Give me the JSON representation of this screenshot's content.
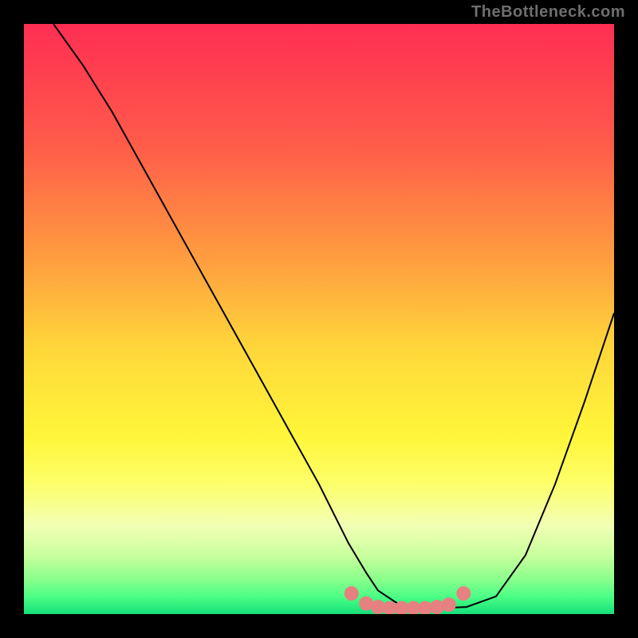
{
  "watermark": "TheBottleneck.com",
  "chart_data": {
    "type": "line",
    "title": "",
    "xlabel": "",
    "ylabel": "",
    "xlim": [
      0,
      100
    ],
    "ylim": [
      0,
      100
    ],
    "series": [
      {
        "name": "bottleneck-curve",
        "color": "#000000",
        "x": [
          5,
          10,
          15,
          20,
          25,
          30,
          35,
          40,
          45,
          50,
          52,
          55,
          58,
          60,
          63,
          65,
          68,
          70,
          75,
          80,
          85,
          90,
          95,
          100
        ],
        "values": [
          100,
          93,
          85,
          76,
          67,
          58,
          49,
          40,
          31,
          22,
          18,
          12,
          7,
          4,
          2,
          1.2,
          1,
          1,
          1.2,
          3,
          10,
          22,
          36,
          51
        ]
      }
    ],
    "markers": {
      "name": "highlight-dots",
      "color": "#e78080",
      "points": [
        {
          "x": 55.5,
          "y": 3.5
        },
        {
          "x": 58.0,
          "y": 1.8
        },
        {
          "x": 60.0,
          "y": 1.2
        },
        {
          "x": 62.0,
          "y": 1.0
        },
        {
          "x": 64.0,
          "y": 1.0
        },
        {
          "x": 66.0,
          "y": 1.0
        },
        {
          "x": 68.0,
          "y": 1.0
        },
        {
          "x": 70.0,
          "y": 1.2
        },
        {
          "x": 72.0,
          "y": 1.6
        },
        {
          "x": 74.5,
          "y": 3.5
        }
      ]
    }
  }
}
